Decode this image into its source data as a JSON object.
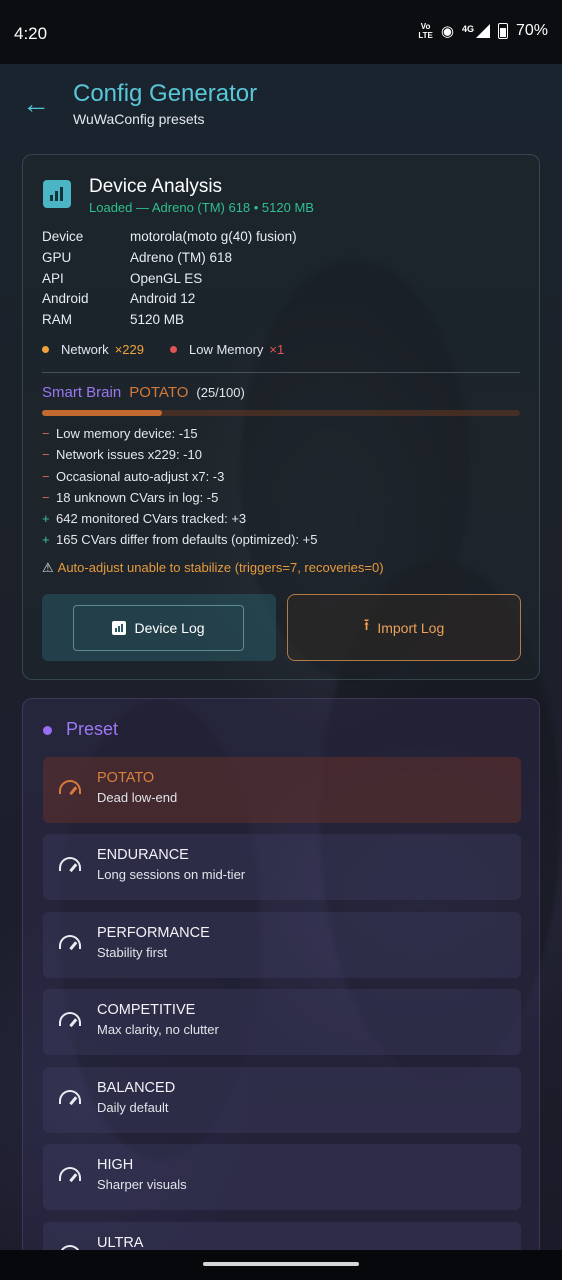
{
  "status_bar": {
    "time": "4:20",
    "volte": "Vo LTE",
    "network": "4G",
    "battery": "70%"
  },
  "header": {
    "title": "Config Generator",
    "subtitle": "WuWaConfig presets"
  },
  "device_analysis": {
    "title": "Device Analysis",
    "status": "Loaded — Adreno (TM) 618 • 5120 MB",
    "rows": [
      {
        "key": "Device",
        "value": "motorola(moto g(40) fusion)"
      },
      {
        "key": "GPU",
        "value": "Adreno (TM) 618"
      },
      {
        "key": "API",
        "value": "OpenGL ES"
      },
      {
        "key": "Android",
        "value": "Android 12"
      },
      {
        "key": "RAM",
        "value": "5120 MB"
      }
    ],
    "flags": [
      {
        "label": "Network",
        "count": "×229",
        "color": "#f0a23c"
      },
      {
        "label": "Low Memory",
        "count": "×1",
        "color": "#e05656"
      }
    ]
  },
  "smart_brain": {
    "label": "Smart Brain",
    "tier": "POTATO",
    "score": "(25/100)",
    "score_fraction": 0.25,
    "factors": [
      {
        "sign": "−",
        "type": "neg",
        "text": "Low memory device: -15"
      },
      {
        "sign": "−",
        "type": "neg",
        "text": "Network issues x229: -10"
      },
      {
        "sign": "−",
        "type": "neg",
        "text": "Occasional auto-adjust x7: -3"
      },
      {
        "sign": "−",
        "type": "neg",
        "text": "18 unknown CVars in log: -5"
      },
      {
        "sign": "+",
        "type": "pos",
        "text": "642 monitored CVars tracked: +3"
      },
      {
        "sign": "+",
        "type": "pos",
        "text": "165 CVars differ from defaults (optimized): +5"
      }
    ],
    "warning_icon": "⚠",
    "warning": "Auto-adjust unable to stabilize (triggers=7, recoveries=0)"
  },
  "buttons": {
    "device_log": "Device Log",
    "import_log": "Import Log"
  },
  "preset_section": {
    "title": "Preset",
    "items": [
      {
        "name": "POTATO",
        "desc": "Dead low-end",
        "selected": true
      },
      {
        "name": "ENDURANCE",
        "desc": "Long sessions on mid-tier",
        "selected": false
      },
      {
        "name": "PERFORMANCE",
        "desc": "Stability first",
        "selected": false
      },
      {
        "name": "COMPETITIVE",
        "desc": "Max clarity, no clutter",
        "selected": false
      },
      {
        "name": "BALANCED",
        "desc": "Daily default",
        "selected": false
      },
      {
        "name": "HIGH",
        "desc": "Sharper visuals",
        "selected": false
      },
      {
        "name": "ULTRA",
        "desc": "",
        "selected": false
      }
    ]
  },
  "colors": {
    "accent_cyan": "#58c7d8",
    "accent_purple": "#9f78f6",
    "accent_orange": "#d9803e",
    "success_green": "#2fbf8f"
  }
}
